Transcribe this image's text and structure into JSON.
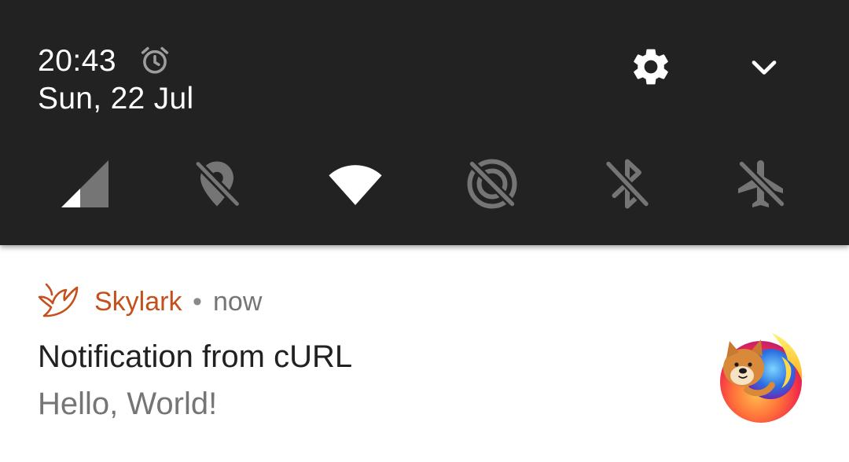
{
  "status": {
    "time": "20:43",
    "date": "Sun, 22 Jul",
    "alarm_icon": "alarm-clock-icon"
  },
  "header_actions": [
    {
      "icon": "settings-gear-icon"
    },
    {
      "icon": "chevron-down-icon"
    }
  ],
  "quick_settings": [
    {
      "icon": "cellular-signal-icon",
      "state": "partial"
    },
    {
      "icon": "location-off-icon",
      "state": "off"
    },
    {
      "icon": "wifi-icon",
      "state": "on"
    },
    {
      "icon": "hotspot-off-icon",
      "state": "off"
    },
    {
      "icon": "bluetooth-off-icon",
      "state": "off"
    },
    {
      "icon": "airplane-mode-off-icon",
      "state": "off"
    }
  ],
  "notification": {
    "app_name": "Skylark",
    "separator": "•",
    "time": "now",
    "title": "Notification from cURL",
    "text": "Hello, World!",
    "app_icon": "skylark-bird-icon",
    "large_icon": "firefox-doge-icon"
  },
  "colors": {
    "shade_background": "#222222",
    "app_accent": "#c4501b",
    "secondary_text": "#757575",
    "primary_text": "#212121"
  }
}
